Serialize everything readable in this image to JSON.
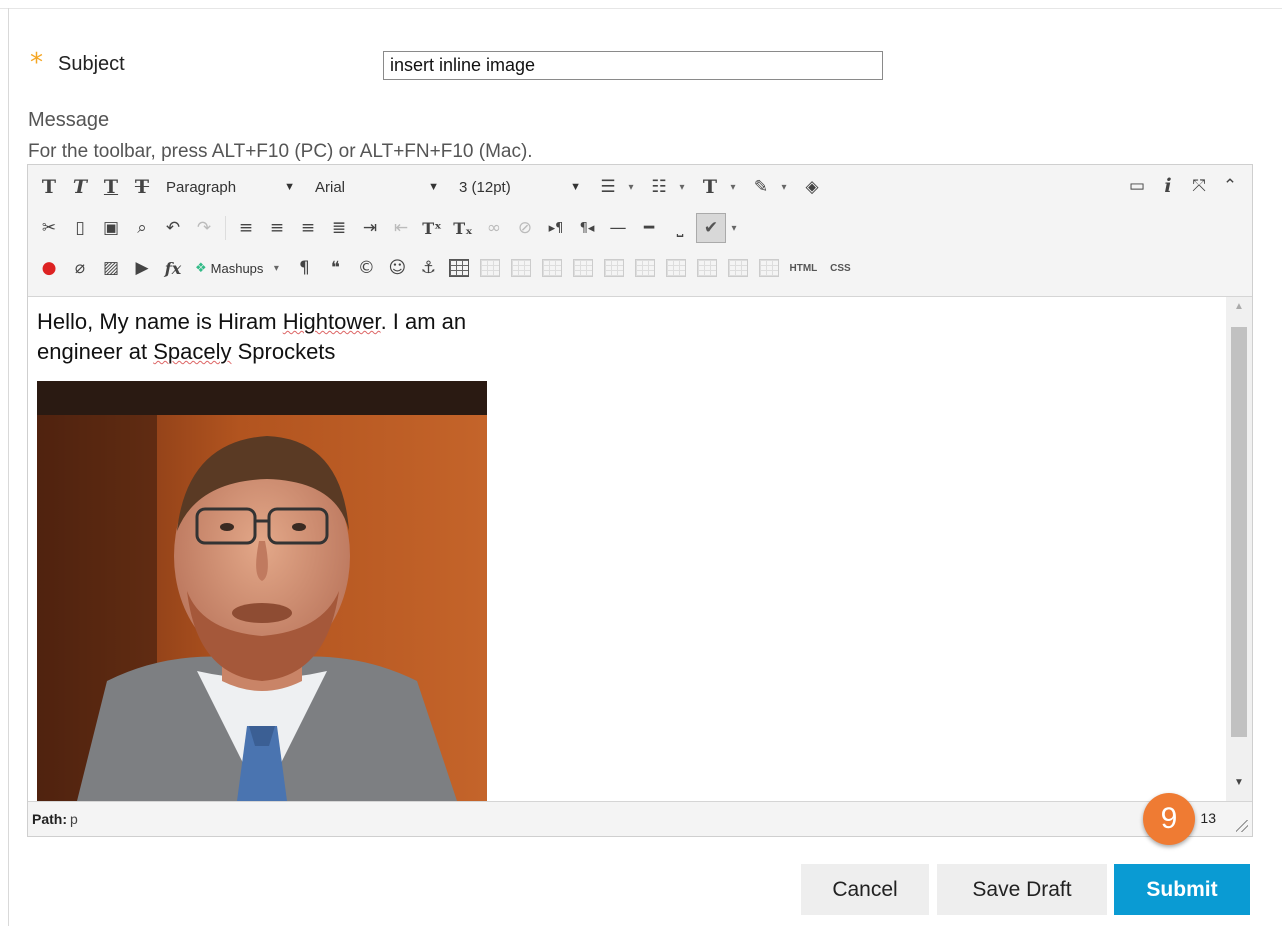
{
  "form": {
    "required_marker": "*",
    "subject_label": "Subject",
    "subject_value": "insert inline image",
    "message_label": "Message",
    "toolbar_hint": "For the toolbar, press ALT+F10 (PC) or ALT+FN+F10 (Mac)."
  },
  "toolbar": {
    "format_block": "Paragraph",
    "font_family": "Arial",
    "font_size": "3 (12pt)",
    "mashups_label": "Mashups",
    "html_label": "HTML",
    "css_label": "CSS",
    "bold_glyph": "T",
    "italic_glyph": "T",
    "underline_glyph": "T",
    "strike_glyph": "T",
    "text_color_glyph": "T",
    "superscript_glyph": "Tˣ",
    "subscript_glyph": "Tₓ",
    "math_glyph": "fx"
  },
  "editor": {
    "content_line1_a": "Hello, My name is Hiram ",
    "content_line1_b": "Hightower",
    "content_line1_c": ". I am an",
    "content_line2_a": "engineer at ",
    "content_line2_b": "Spacely",
    "content_line2_c": " Sprockets",
    "path_label": "Path:",
    "path_value": "p",
    "word_count": "13"
  },
  "annotation": {
    "step_number": "9"
  },
  "actions": {
    "cancel": "Cancel",
    "save_draft": "Save Draft",
    "submit": "Submit"
  },
  "colors": {
    "accent_submit": "#0a9bd3",
    "required_star": "#f5a623",
    "step_badge": "#ef7b33"
  }
}
